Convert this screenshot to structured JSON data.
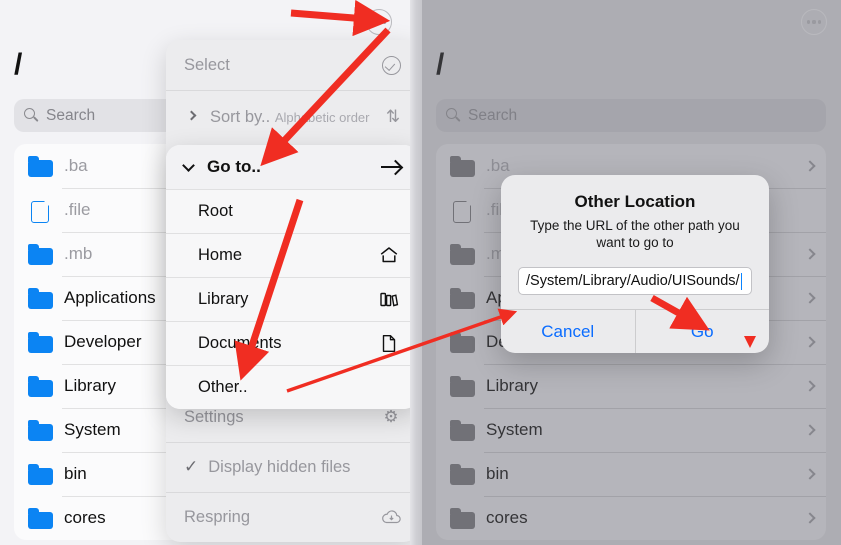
{
  "left_panel": {
    "title": "/",
    "search": {
      "placeholder": "Search"
    },
    "more_icon": "ellipsis-circle-icon",
    "items": [
      {
        "name": ".ba",
        "icon": "folder-icon",
        "dim": true
      },
      {
        "name": ".file",
        "icon": "document-icon",
        "dim": true
      },
      {
        "name": ".mb",
        "icon": "folder-icon",
        "dim": true
      },
      {
        "name": "Applications",
        "icon": "folder-icon",
        "dim": false
      },
      {
        "name": "Developer",
        "icon": "folder-icon",
        "dim": false
      },
      {
        "name": "Library",
        "icon": "folder-icon",
        "dim": false
      },
      {
        "name": "System",
        "icon": "folder-icon",
        "dim": false
      },
      {
        "name": "bin",
        "icon": "folder-icon",
        "dim": false
      },
      {
        "name": "cores",
        "icon": "folder-icon",
        "dim": false
      }
    ]
  },
  "right_panel": {
    "title": "/",
    "search": {
      "placeholder": "Search"
    },
    "more_icon": "ellipsis-circle-icon",
    "items": [
      {
        "name": ".ba",
        "icon": "folder-icon",
        "dim": true
      },
      {
        "name": ".file",
        "icon": "document-icon",
        "dim": true
      },
      {
        "name": ".mb",
        "icon": "folder-icon",
        "dim": true
      },
      {
        "name": "Applications",
        "icon": "folder-icon",
        "dim": false
      },
      {
        "name": "Developer",
        "icon": "folder-icon",
        "dim": false
      },
      {
        "name": "Library",
        "icon": "folder-icon",
        "dim": false
      },
      {
        "name": "System",
        "icon": "folder-icon",
        "dim": false
      },
      {
        "name": "bin",
        "icon": "folder-icon",
        "dim": false
      },
      {
        "name": "cores",
        "icon": "folder-icon",
        "dim": false
      }
    ]
  },
  "context_menu": {
    "select": {
      "label": "Select",
      "icon": "check-circle-icon"
    },
    "sort_by": {
      "label": "Sort by..",
      "sublabel": "Alphabetic order",
      "icon": "sort-arrows-icon"
    },
    "settings": {
      "label": "Settings",
      "icon": "gear-icon"
    },
    "display_hidden": {
      "label": "Display hidden files",
      "checked_icon": "checkmark-icon"
    },
    "respring": {
      "label": "Respring",
      "icon": "cloud-refresh-icon"
    }
  },
  "goto_group": {
    "header": {
      "label": "Go to..",
      "expand_icon": "chevron-down-icon",
      "action_icon": "arrow-right-icon"
    },
    "items": [
      {
        "label": "Root",
        "icon": ""
      },
      {
        "label": "Home",
        "icon": "house-icon"
      },
      {
        "label": "Library",
        "icon": "books-icon"
      },
      {
        "label": "Documents",
        "icon": "document-icon"
      },
      {
        "label": "Other..",
        "icon": ""
      }
    ]
  },
  "alert": {
    "title": "Other Location",
    "message": "Type the URL of the other path you want to go to",
    "input_value": "/System/Library/Audio/UISounds/",
    "cancel_label": "Cancel",
    "go_label": "Go"
  },
  "colors": {
    "folder_blue": "#0b84f3",
    "action_blue": "#0a6cff",
    "annotation_red": "#f02d22"
  }
}
